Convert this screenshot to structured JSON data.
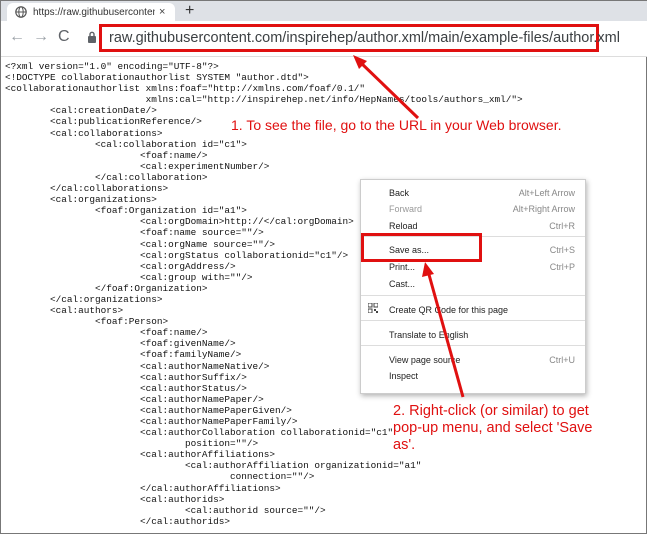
{
  "browser": {
    "tab_title": "https://raw.githubusercontent.co",
    "tab_close": "×",
    "new_tab": "+",
    "nav": {
      "back": "←",
      "forward": "→",
      "reload": "C"
    },
    "url": "raw.githubusercontent.com/inspirehep/author.xml/main/example-files/author.xml"
  },
  "source_lines": [
    "<?xml version=\"1.0\" encoding=\"UTF-8\"?>",
    "<!DOCTYPE collaborationauthorlist SYSTEM \"author.dtd\">",
    "<collaborationauthorlist xmlns:foaf=\"http://xmlns.com/foaf/0.1/\"",
    "                         xmlns:cal=\"http://inspirehep.net/info/HepNames/tools/authors_xml/\">",
    "        <cal:creationDate/>",
    "        <cal:publicationReference/>",
    "        <cal:collaborations>",
    "                <cal:collaboration id=\"c1\">",
    "                        <foaf:name/>",
    "                        <cal:experimentNumber/>",
    "                </cal:collaboration>",
    "        </cal:collaborations>",
    "        <cal:organizations>",
    "                <foaf:Organization id=\"a1\">",
    "                        <cal:orgDomain>http://</cal:orgDomain>",
    "                        <foaf:name source=\"\"/>",
    "                        <cal:orgName source=\"\"/>",
    "                        <cal:orgStatus collaborationid=\"c1\"/>",
    "                        <cal:orgAddress/>",
    "                        <cal:group with=\"\"/>",
    "                </foaf:Organization>",
    "        </cal:organizations>",
    "        <cal:authors>",
    "                <foaf:Person>",
    "                        <foaf:name/>",
    "                        <foaf:givenName/>",
    "                        <foaf:familyName/>",
    "                        <cal:authorNameNative/>",
    "                        <cal:authorSuffix/>",
    "                        <cal:authorStatus/>",
    "                        <cal:authorNamePaper/>",
    "                        <cal:authorNamePaperGiven/>",
    "                        <cal:authorNamePaperFamily/>",
    "                        <cal:authorCollaboration collaborationid=\"c1\"",
    "                                position=\"\"/>",
    "                        <cal:authorAffiliations>",
    "                                <cal:authorAffiliation organizationid=\"a1\"",
    "                                        connection=\"\"/>",
    "                        </cal:authorAffiliations>",
    "                        <cal:authorids>",
    "                                <cal:authorid source=\"\"/>",
    "                        </cal:authorids>"
  ],
  "context_menu": {
    "items": [
      {
        "label": "Back",
        "shortcut": "Alt+Left Arrow",
        "disabled": false
      },
      {
        "label": "Forward",
        "shortcut": "Alt+Right Arrow",
        "disabled": true
      },
      {
        "label": "Reload",
        "shortcut": "Ctrl+R",
        "disabled": false
      },
      {
        "label": "Save as...",
        "shortcut": "Ctrl+S",
        "disabled": false
      },
      {
        "label": "Print...",
        "shortcut": "Ctrl+P",
        "disabled": false
      },
      {
        "label": "Cast...",
        "shortcut": "",
        "disabled": false
      },
      {
        "label": "Create QR Code for this page",
        "shortcut": "",
        "disabled": false
      },
      {
        "label": "Translate to English",
        "shortcut": "",
        "disabled": false
      },
      {
        "label": "View page source",
        "shortcut": "Ctrl+U",
        "disabled": false
      },
      {
        "label": "Inspect",
        "shortcut": "",
        "disabled": false
      }
    ]
  },
  "annotations": {
    "step1": "1. To see the file, go to the URL in your Web browser.",
    "step2": "2. Right-click (or similar) to get pop-up menu, and select 'Save as'."
  },
  "colors": {
    "annotation": "#e01010",
    "tabstrip": "#dee1e6"
  }
}
